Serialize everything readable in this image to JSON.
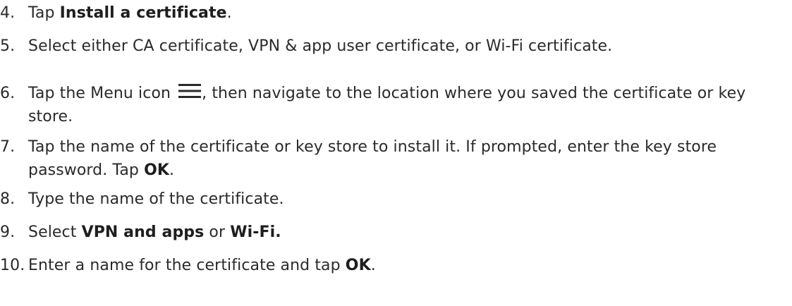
{
  "steps": [
    {
      "number": "4.",
      "parts": [
        {
          "text": "Tap ",
          "bold": false
        },
        {
          "text": "Install a certificate",
          "bold": true
        },
        {
          "text": ".",
          "bold": false
        }
      ]
    },
    {
      "number": "5.",
      "parts": [
        {
          "text": "Select either CA certificate, VPN & app user certificate, or Wi-Fi certificate.",
          "bold": false
        }
      ]
    },
    {
      "number": "6.",
      "parts": [
        {
          "text": "Tap the Menu icon",
          "bold": false
        },
        {
          "icon": "menu-icon"
        },
        {
          "text": ", then navigate to the location where you saved the certificate or key store.",
          "bold": false
        }
      ]
    },
    {
      "number": "7.",
      "parts": [
        {
          "text": "Tap the name of the certificate or key store to install it. If prompted, enter the key store password. Tap ",
          "bold": false
        },
        {
          "text": "OK",
          "bold": true
        },
        {
          "text": ".",
          "bold": false
        }
      ]
    },
    {
      "number": "8.",
      "parts": [
        {
          "text": "Type the name of the certificate.",
          "bold": false
        }
      ]
    },
    {
      "number": "9.",
      "parts": [
        {
          "text": "Select ",
          "bold": false
        },
        {
          "text": "VPN and apps",
          "bold": true
        },
        {
          "text": " or ",
          "bold": false
        },
        {
          "text": "Wi-Fi.",
          "bold": true
        }
      ]
    },
    {
      "number": "10.",
      "parts": [
        {
          "text": "Enter a name for the certificate and tap ",
          "bold": false
        },
        {
          "text": "OK",
          "bold": true
        },
        {
          "text": ".",
          "bold": false
        }
      ]
    }
  ]
}
